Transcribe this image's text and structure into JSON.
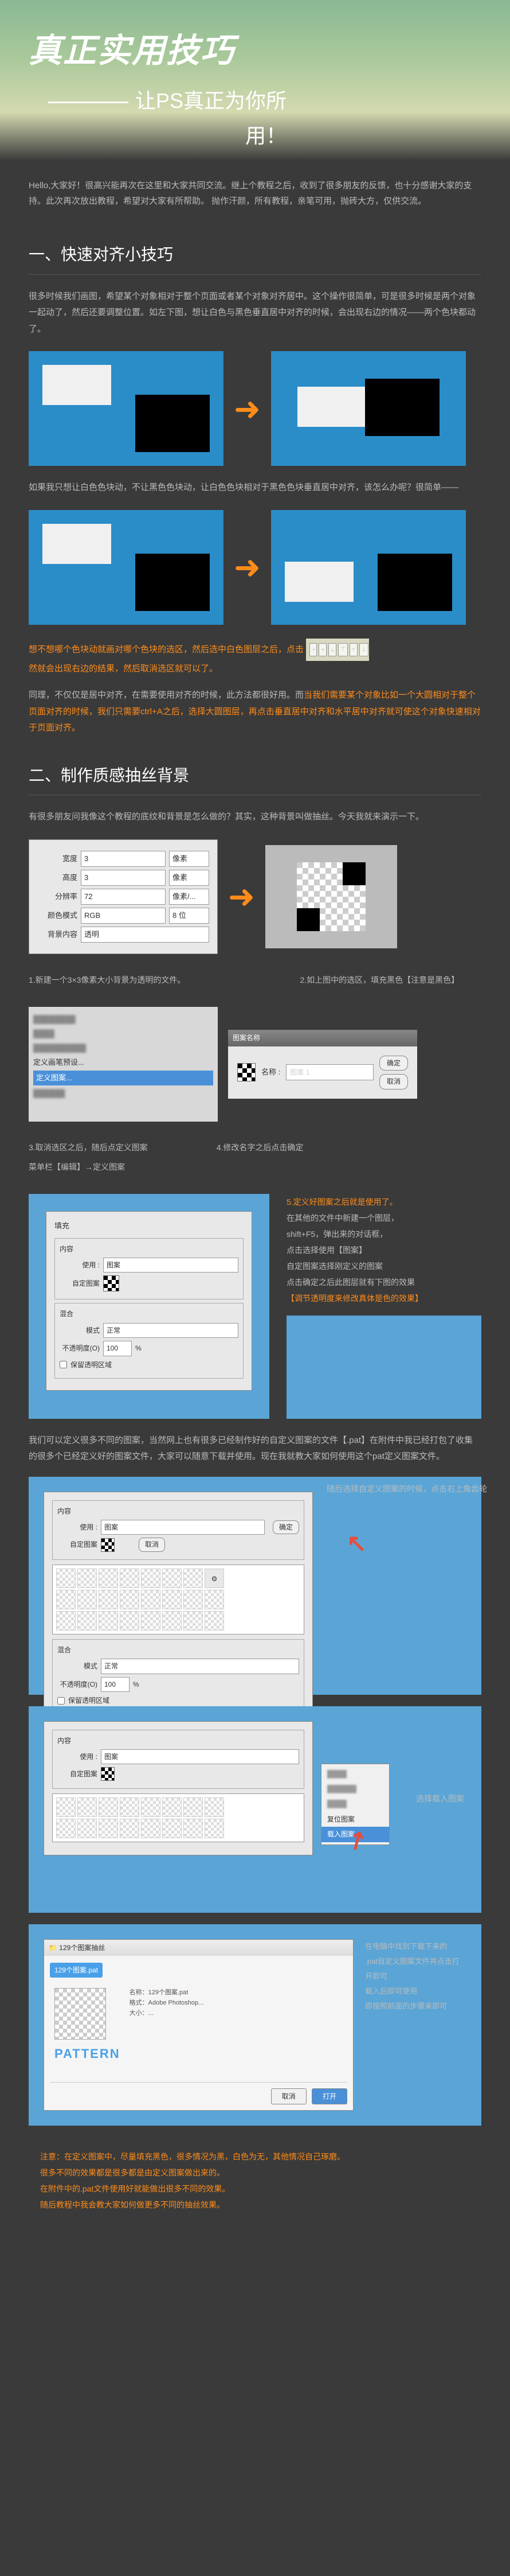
{
  "banner": {
    "title": "真正实用技巧",
    "subtitle": "让PS真正为你所用！"
  },
  "intro": "Hello,大家好！很高兴能再次在这里和大家共同交流。继上个教程之后，收到了很多朋友的反馈，也十分感谢大家的支持。此次再次放出教程，希望对大家有所帮助。\n抛作汗颜，所有教程，亲笔可用，抛砖大方，仅供交流。",
  "section1": {
    "title": "一、快速对齐小技巧",
    "p1": "很多时候我们画图，希望某个对象相对于整个页面或者某个对象对齐居中。这个操作很简单，可是很多时候是两个对象一起动了，然后还要调整位置。如左下图，想让白色与黑色垂直居中对齐的时候，会出现右边的情况——两个色块都动了。",
    "p2": "如果我只想让白色色块动，不让黑色色块动，让白色色块相对于黑色色块垂直居中对齐，该怎么办呢？很简单——",
    "p3_a": "想不想哪个色块动就画对哪个色块的选区，然后选中白色图层之后，点击",
    "p3_b": "然就会出现右边的结果，然后取消选区就可以了。",
    "align_panel": {
      "r1": [
        "左",
        "中",
        "右",
        "上",
        "中",
        "下"
      ],
      "r2": [
        "左",
        "中",
        "右",
        "上",
        "中",
        "下"
      ]
    },
    "p4_a": "同理，不仅仅是居中对齐，在需要使用对齐的时候，此方法都很好用。而",
    "p4_b": "当我们需要某个对象比如一个大圆相对于整个页面对齐的时候，我们只需要ctrl+A之后，选择大圆图层，再点击垂直居中对齐和水平居中对齐就可使这个对象快速相对于页面对齐。"
  },
  "section2": {
    "title": "二、制作质感抽丝背景",
    "p1": "有很多朋友问我像这个教程的底纹和背景是怎么做的？其实，这种背景叫做抽丝。今天我就来演示一下。",
    "newdoc": {
      "fields": {
        "width": "宽度",
        "height": "高度",
        "res": "分辨率",
        "mode": "颜色模式",
        "bg": "背景内容"
      },
      "vals": {
        "w": "3",
        "h": "3",
        "r": "72",
        "m": "RGB",
        "b": "透明"
      },
      "units": {
        "px": "像素",
        "ppi": "像素/...",
        "bit": "8 位"
      }
    },
    "cap1": "1.新建一个3×3像素大小背景为透明的文件。",
    "cap2": "2.如上图中的选区，填充黑色【注意是黑色】",
    "menu": {
      "item": "定义图案...",
      "sub": "菜单栏【编辑】→定义图案"
    },
    "cap3": "3.取消选区之后，随后点定义图案",
    "cap4": "4.修改名字之后点击确定",
    "pattern_name": {
      "title": "图案名称",
      "label": "名称 :",
      "value": "图案 1",
      "ok": "确定",
      "cancel": "取消"
    },
    "notes5": {
      "t": "5.定义好图案之后就是使用了。",
      "l1": "在其他的文件中新建一个图层，",
      "l2": "shift+F5，弹出来的对话框，",
      "l3": "点击选择使用【图案】",
      "l4": "自定图案选择刚定义的图案",
      "l5": "点击确定之后此图层就有下图的效果",
      "l6": "【调节透明度来修改真体是色的效果】"
    },
    "fill": {
      "title": "填充",
      "content": "内容",
      "use": "使用 :",
      "pattern": "图案",
      "custom": "自定图案",
      "blend": "混合",
      "mode": "模式",
      "normal": "正常",
      "opacity": "不透明度(O)",
      "pct": "100",
      "ok": "确定",
      "cancel": "取消",
      "keep": "保留透明区域"
    },
    "p5": "我们可以定义很多不同的图案，当然网上也有很多已经制作好的自定义图案的文件【.pat】在附件中我已经打包了收集的很多个已经定义好的图案文件，大家可以随意下载并使用。现在我就教大家如何使用这个pat定义图案文件。",
    "label_a": "随后选择自定义图案的时候，点击右上角齿轮",
    "label_b": "选择载入图案",
    "gear": {
      "reset": "复位图案",
      "load": "载入图案"
    },
    "explorer": {
      "title": "129个图案抽丝",
      "crumb": "129个图案.pat",
      "pattern": "PATTERN",
      "meta1": "名称：129个图案.pat",
      "meta2": "格式：Adobe Photoshop...",
      "meta3": "大小：...",
      "open": "打开",
      "cancel": "取消"
    },
    "notes_ex": {
      "l1": "在电脑中找到下载下来的",
      "l2": ".pat自定义图案文件并点击打开即可",
      "l3": "载入后即可使用",
      "l4": "即按照前面的步骤来即可"
    }
  },
  "footnote": {
    "l1": "注意：在定义图案中，尽量填充黑色，很多情况为黑，白色为无，其他情况自己琢磨。",
    "l2": "很多不同的效果都是很多都是由定义图案做出来的。",
    "l3": "在附件中的.pat文件使用好就能做出很多不同的效果。",
    "l4": "随后教程中我会教大家如何做更多不同的抽丝效果。"
  }
}
